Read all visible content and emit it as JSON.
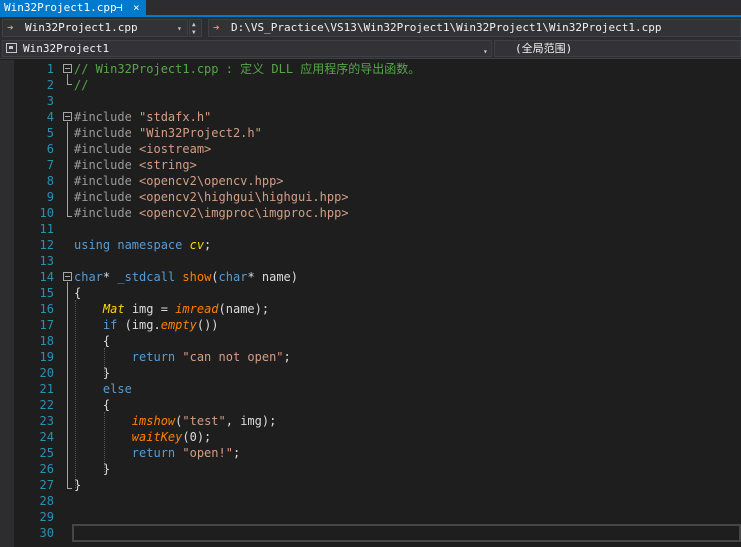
{
  "tab": {
    "title": "Win32Project1.cpp",
    "pin_glyph": "⊣",
    "close_glyph": "×"
  },
  "navbar": {
    "file_combo": "Win32Project1.cpp",
    "path_combo": "D:\\VS_Practice\\VS13\\Win32Project1\\Win32Project1\\Win32Project1.cpp",
    "arrow_glyph": "➔",
    "drop_glyph": "▾",
    "spin_up": "▲",
    "spin_down": "▼"
  },
  "scope": {
    "project": "Win32Project1",
    "global": "(全局范围)"
  },
  "colors": {
    "accent": "#007acc",
    "line_number": "#2b91af",
    "comment": "#57a64a",
    "keyword": "#569cd6",
    "string": "#d69d85",
    "function": "#ff8000",
    "type": "#ffd700"
  },
  "editor": {
    "line_numbers": [
      "1",
      "2",
      "3",
      "4",
      "5",
      "6",
      "7",
      "8",
      "9",
      "10",
      "11",
      "12",
      "13",
      "14",
      "15",
      "16",
      "17",
      "18",
      "19",
      "20",
      "21",
      "22",
      "23",
      "24",
      "25",
      "26",
      "27",
      "28",
      "29",
      "30"
    ],
    "lines": [
      [
        {
          "c": "c-com",
          "t": "// Win32Project1.cpp : 定义 DLL 应用程序的导出函数。"
        }
      ],
      [
        {
          "c": "c-com",
          "t": "//"
        }
      ],
      [],
      [
        {
          "c": "c-pp",
          "t": "#include "
        },
        {
          "c": "c-str",
          "t": "\"stdafx.h\""
        }
      ],
      [
        {
          "c": "c-pp",
          "t": "#include "
        },
        {
          "c": "c-str",
          "t": "\"Win32Project2.h\""
        }
      ],
      [
        {
          "c": "c-pp",
          "t": "#include "
        },
        {
          "c": "c-str",
          "t": "<iostream>"
        }
      ],
      [
        {
          "c": "c-pp",
          "t": "#include "
        },
        {
          "c": "c-str",
          "t": "<string>"
        }
      ],
      [
        {
          "c": "c-pp",
          "t": "#include "
        },
        {
          "c": "c-str",
          "t": "<opencv2\\opencv.hpp>"
        }
      ],
      [
        {
          "c": "c-pp",
          "t": "#include "
        },
        {
          "c": "c-str",
          "t": "<opencv2\\highgui\\highgui.hpp>"
        }
      ],
      [
        {
          "c": "c-pp",
          "t": "#include "
        },
        {
          "c": "c-str",
          "t": "<opencv2\\imgproc\\imgproc.hpp>"
        }
      ],
      [],
      [
        {
          "c": "c-kw",
          "t": "using namespace "
        },
        {
          "c": "c-ns",
          "t": "cv"
        },
        {
          "c": "c-txt",
          "t": ";"
        }
      ],
      [],
      [
        {
          "c": "c-kw",
          "t": "char"
        },
        {
          "c": "c-txt",
          "t": "* "
        },
        {
          "c": "c-kw",
          "t": "_stdcall "
        },
        {
          "c": "c-fn2",
          "t": "show"
        },
        {
          "c": "c-txt",
          "t": "("
        },
        {
          "c": "c-kw",
          "t": "char"
        },
        {
          "c": "c-txt",
          "t": "* name)"
        }
      ],
      [
        {
          "c": "c-txt",
          "t": "{"
        }
      ],
      [
        {
          "c": "c-txt",
          "t": "    "
        },
        {
          "c": "c-type",
          "t": "Mat"
        },
        {
          "c": "c-txt",
          "t": " img = "
        },
        {
          "c": "c-fn",
          "t": "imread"
        },
        {
          "c": "c-txt",
          "t": "(name);"
        }
      ],
      [
        {
          "c": "c-txt",
          "t": "    "
        },
        {
          "c": "c-kw",
          "t": "if"
        },
        {
          "c": "c-txt",
          "t": " (img."
        },
        {
          "c": "c-fn",
          "t": "empty"
        },
        {
          "c": "c-txt",
          "t": "())"
        }
      ],
      [
        {
          "c": "c-txt",
          "t": "    {"
        }
      ],
      [
        {
          "c": "c-txt",
          "t": "        "
        },
        {
          "c": "c-kw",
          "t": "return "
        },
        {
          "c": "c-str",
          "t": "\"can not open\""
        },
        {
          "c": "c-txt",
          "t": ";"
        }
      ],
      [
        {
          "c": "c-txt",
          "t": "    }"
        }
      ],
      [
        {
          "c": "c-txt",
          "t": "    "
        },
        {
          "c": "c-kw",
          "t": "else"
        }
      ],
      [
        {
          "c": "c-txt",
          "t": "    {"
        }
      ],
      [
        {
          "c": "c-txt",
          "t": "        "
        },
        {
          "c": "c-fn",
          "t": "imshow"
        },
        {
          "c": "c-txt",
          "t": "("
        },
        {
          "c": "c-str",
          "t": "\"test\""
        },
        {
          "c": "c-txt",
          "t": ", img);"
        }
      ],
      [
        {
          "c": "c-txt",
          "t": "        "
        },
        {
          "c": "c-fn",
          "t": "waitKey"
        },
        {
          "c": "c-txt",
          "t": "(0);"
        }
      ],
      [
        {
          "c": "c-txt",
          "t": "        "
        },
        {
          "c": "c-kw",
          "t": "return "
        },
        {
          "c": "c-str",
          "t": "\"open!\""
        },
        {
          "c": "c-txt",
          "t": ";"
        }
      ],
      [
        {
          "c": "c-txt",
          "t": "    }"
        }
      ],
      [
        {
          "c": "c-txt",
          "t": "}"
        }
      ],
      [],
      [],
      []
    ]
  }
}
